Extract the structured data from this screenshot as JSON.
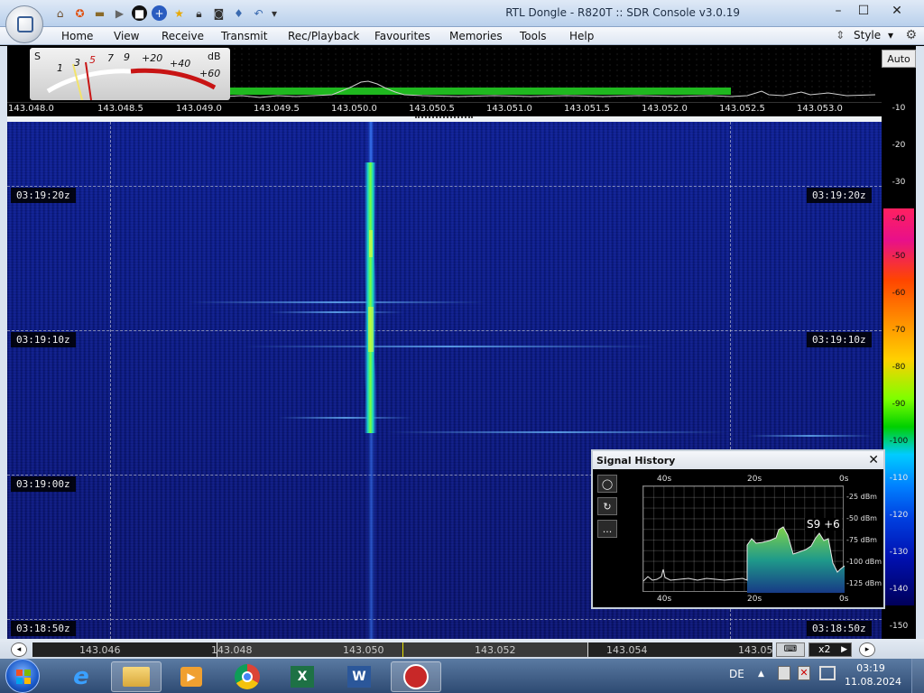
{
  "app": {
    "title": "RTL Dongle - R820T :: SDR Console v3.0.19",
    "quick_access_icons": [
      "home-icon",
      "lifebuoy-icon",
      "folder-icon",
      "play-icon",
      "stop-icon",
      "add-icon",
      "favourite-star-icon",
      "lock-icon",
      "camera-icon",
      "drop-icon",
      "undo-icon",
      "dropdown-icon"
    ]
  },
  "menu": {
    "items": [
      "Home",
      "View",
      "Receive",
      "Transmit",
      "Rec/Playback",
      "Favourites",
      "Memories",
      "Tools",
      "Help"
    ],
    "style_label": "Style"
  },
  "smeter": {
    "s_label": "S",
    "db_label": "dB",
    "scale_s": [
      "1",
      "3",
      "5",
      "7",
      "9"
    ],
    "scale_over": [
      "+20",
      "+40",
      "+60"
    ]
  },
  "frequency_axis": {
    "labels": [
      "143.048.0",
      "143.048.5",
      "143.049.0",
      "143.049.5",
      "143.050.0",
      "143.050.5",
      "143.051.0",
      "143.051.5",
      "143.052.0",
      "143.052.5",
      "143.053.0"
    ]
  },
  "level_scale": {
    "auto_label": "Auto",
    "ticks": [
      "-10",
      "-20",
      "-30",
      "-40",
      "-50",
      "-60",
      "-70",
      "-80",
      "-90",
      "-100",
      "-110",
      "-120",
      "-130",
      "-140",
      "-150"
    ]
  },
  "waterfall": {
    "time_labels": [
      "03:19:20z",
      "03:19:10z",
      "03:19:00z",
      "03:18:50z"
    ]
  },
  "signal_history": {
    "title": "Signal History",
    "close_icon": "close-icon",
    "x_labels_top": [
      "40s",
      "20s",
      "0s"
    ],
    "x_labels_bottom": [
      "40s",
      "20s",
      "0s"
    ],
    "y_labels": [
      "-25 dBm",
      "-50 dBm",
      "-75 dBm",
      "-100 dBm",
      "-125 dBm"
    ],
    "readout": "S9 +6",
    "buttons": [
      "record-icon",
      "reset-icon",
      "more-icon"
    ],
    "more_label": "..."
  },
  "bottom_scroll": {
    "labels": [
      "143.046",
      "143.048",
      "143.050",
      "143.052",
      "143.054",
      "143.05"
    ],
    "zoom_label": "x2"
  },
  "taskbar": {
    "apps": [
      "internet-explorer-icon",
      "file-explorer-icon",
      "media-player-icon",
      "chrome-icon",
      "excel-icon",
      "word-icon",
      "sdr-console-icon"
    ],
    "language": "DE",
    "time": "03:19",
    "date": "11.08.2024"
  }
}
